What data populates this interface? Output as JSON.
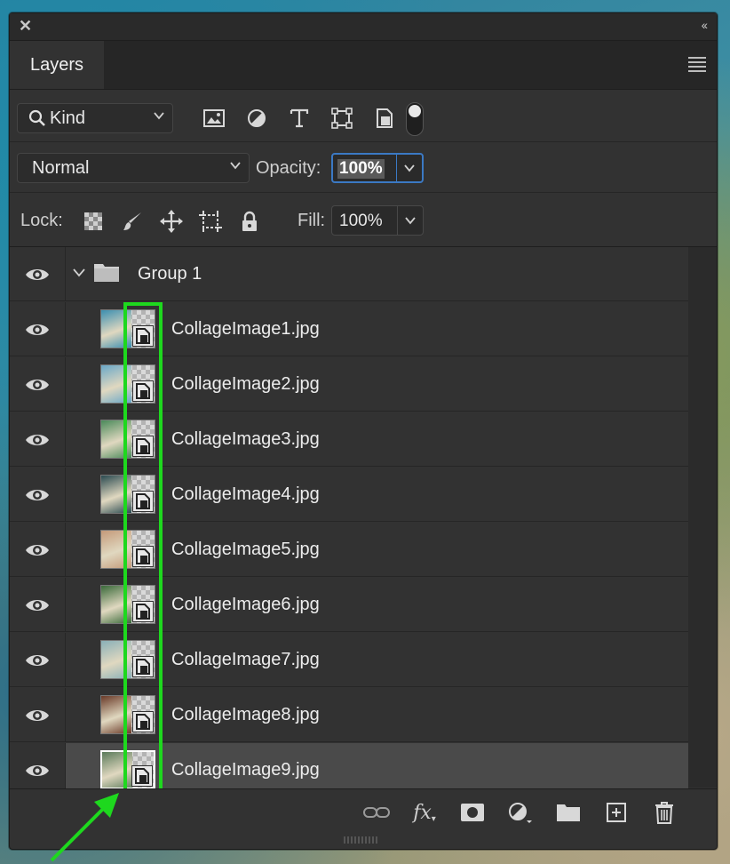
{
  "panel": {
    "close_glyph": "✕",
    "collapse_glyph": "‹‹",
    "tab_label": "Layers",
    "menu_icon": "panel-menu-icon"
  },
  "filter": {
    "kind_label": "Kind",
    "icons": [
      "pixel-layer-filter-icon",
      "adjustment-layer-filter-icon",
      "type-layer-filter-icon",
      "shape-layer-filter-icon",
      "smart-object-filter-icon"
    ],
    "toggle_on": true
  },
  "blend": {
    "mode": "Normal",
    "opacity_label": "Opacity:",
    "opacity_value": "100%"
  },
  "lock": {
    "label": "Lock:",
    "icons": [
      "lock-transparent-pixels-icon",
      "lock-image-pixels-icon",
      "lock-position-icon",
      "lock-artboard-icon",
      "lock-all-icon"
    ],
    "fill_label": "Fill:",
    "fill_value": "100%"
  },
  "layers": {
    "group": {
      "name": "Group 1",
      "visible": true,
      "expanded": true
    },
    "items": [
      {
        "name": "CollageImage1.jpg",
        "visible": true,
        "color": "#3b8fb0"
      },
      {
        "name": "CollageImage2.jpg",
        "visible": true,
        "color": "#6aa8c8"
      },
      {
        "name": "CollageImage3.jpg",
        "visible": true,
        "color": "#4a8a5a"
      },
      {
        "name": "CollageImage4.jpg",
        "visible": true,
        "color": "#2a4a50"
      },
      {
        "name": "CollageImage5.jpg",
        "visible": true,
        "color": "#c49a7a"
      },
      {
        "name": "CollageImage6.jpg",
        "visible": true,
        "color": "#3a6a3a"
      },
      {
        "name": "CollageImage7.jpg",
        "visible": true,
        "color": "#8ab0b8"
      },
      {
        "name": "CollageImage8.jpg",
        "visible": true,
        "color": "#6a3a28"
      },
      {
        "name": "CollageImage9.jpg",
        "visible": true,
        "color": "#5a7a5a",
        "selected": true
      }
    ]
  },
  "footer": {
    "icons": [
      "link-layers-icon",
      "fx-icon",
      "add-mask-icon",
      "new-adjustment-layer-icon",
      "new-group-icon",
      "new-layer-icon",
      "delete-layer-icon"
    ],
    "fx_text": "fx"
  },
  "annotation": {
    "highlight_color": "#1ed81e"
  }
}
